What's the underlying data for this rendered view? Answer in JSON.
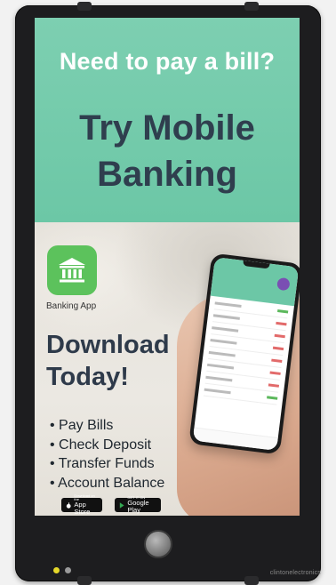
{
  "banner": {
    "headline": "Need to pay a bill?",
    "title_line1": "Try Mobile",
    "title_line2": "Banking"
  },
  "app": {
    "label": "Banking App",
    "icon": "bank-building-icon",
    "icon_color": "#5cc25c"
  },
  "promo": {
    "line1": "Download",
    "line2": "Today!",
    "features": [
      "Pay Bills",
      "Check Deposit",
      "Transfer Funds",
      "Account Balance"
    ]
  },
  "stores": {
    "apple": {
      "small": "Download on the",
      "big": "App Store"
    },
    "google": {
      "small": "GET IT ON",
      "big": "Google Play"
    }
  },
  "device": {
    "brand": "clintonelectronics",
    "led_colors": [
      "#e6d82a",
      "#9a9a9a"
    ]
  },
  "colors": {
    "banner_green": "#6cc7a6",
    "title_navy": "#2f3e4e",
    "headline_white": "#ffffff"
  }
}
